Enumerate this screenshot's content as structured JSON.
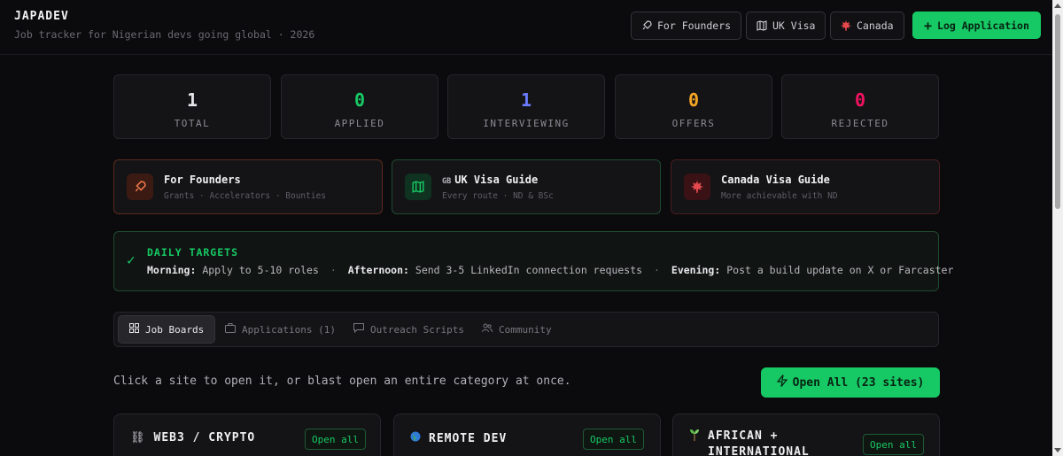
{
  "header": {
    "brand": "JAPADEV",
    "tagline": "Job tracker for Nigerian devs going global · 2026",
    "buttons": {
      "founders": "For Founders",
      "uk_visa": "UK Visa",
      "canada": "Canada",
      "log_application": "Log Application"
    }
  },
  "stats": [
    {
      "value": "1",
      "label": "TOTAL",
      "color": "#e6e6ea"
    },
    {
      "value": "0",
      "label": "APPLIED",
      "color": "#17c964"
    },
    {
      "value": "1",
      "label": "INTERVIEWING",
      "color": "#6b7cff"
    },
    {
      "value": "0",
      "label": "OFFERS",
      "color": "#f5a524"
    },
    {
      "value": "0",
      "label": "REJECTED",
      "color": "#f31260"
    }
  ],
  "guides": [
    {
      "title": "For Founders",
      "subtitle": "Grants · Accelerators · Bounties"
    },
    {
      "flag": "GB",
      "title": "UK Visa Guide",
      "subtitle": "Every route · ND & BSc"
    },
    {
      "title": "Canada Visa Guide",
      "subtitle": "More achievable with ND"
    }
  ],
  "targets": {
    "title": "DAILY TARGETS",
    "morning_label": "Morning:",
    "morning_text": "Apply to 5-10 roles",
    "afternoon_label": "Afternoon:",
    "afternoon_text": "Send 3-5 LinkedIn connection requests",
    "evening_label": "Evening:",
    "evening_text": "Post a build update on X or Farcaster"
  },
  "tabs": {
    "job_boards": "Job Boards",
    "applications": "Applications (1)",
    "outreach": "Outreach Scripts",
    "community": "Community"
  },
  "hint": "Click a site to open it, or blast open an entire category at once.",
  "open_all": "Open All (23 sites)",
  "categories": [
    {
      "title": "WEB3 / CRYPTO",
      "button": "Open all"
    },
    {
      "title": "REMOTE DEV",
      "button": "Open all"
    },
    {
      "title_line1": "AFRICAN +",
      "title_line2": "INTERNATIONAL",
      "button": "Open all"
    }
  ],
  "colors": {
    "accent": "#17c964",
    "background": "#0b0b0d"
  }
}
